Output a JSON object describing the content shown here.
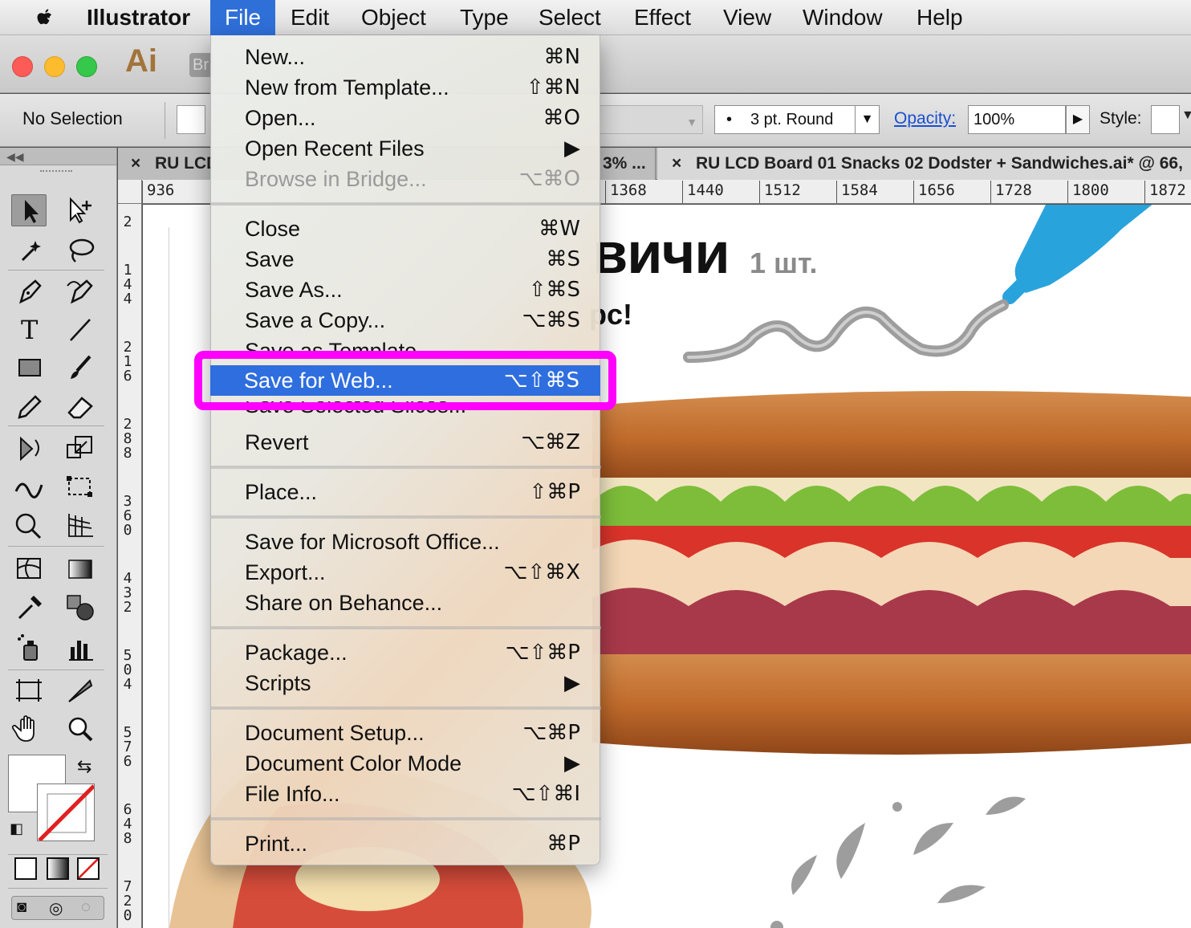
{
  "menubar": {
    "app_name": "Illustrator",
    "items": [
      "File",
      "Edit",
      "Object",
      "Type",
      "Select",
      "Effect",
      "View",
      "Window",
      "Help"
    ]
  },
  "appbar": {
    "logo": "Ai",
    "bridge_label": "Br"
  },
  "controlbar": {
    "selection": "No Selection",
    "brush_dot": "•",
    "brush": "3 pt. Round",
    "opacity_label": "Opacity:",
    "opacity_value": "100%",
    "style_label": "Style:"
  },
  "doc_tabs": {
    "tab1": "RU LCD",
    "tab2": "3% ...",
    "tab3": "RU LCD Board 01 Snacks 02 Dodster + Sandwiches.ai* @ 66,",
    "close_glyph": "×"
  },
  "hruler": [
    "936",
    "1368",
    "1440",
    "1512",
    "1584",
    "1656",
    "1728",
    "1800",
    "1872"
  ],
  "vruler": [
    "2",
    "1\n4\n4",
    "2\n1\n6",
    "2\n8\n8",
    "3\n6\n0",
    "4\n3\n2",
    "5\n0\n4",
    "5\n7\n6",
    "6\n4\n8",
    "7\n2\n0"
  ],
  "canvas": {
    "headline": "вичи",
    "headline_qty": "1 шт.",
    "subline": "рс!"
  },
  "file_menu": {
    "items": [
      {
        "label": "New...",
        "shortcut": "⌘N"
      },
      {
        "label": "New from Template...",
        "shortcut": "⇧⌘N"
      },
      {
        "label": "Open...",
        "shortcut": "⌘O"
      },
      {
        "label": "Open Recent Files",
        "shortcut": "▶"
      },
      {
        "label": "Browse in Bridge...",
        "shortcut": "⌥⌘O"
      },
      {
        "label": "Close",
        "shortcut": "⌘W"
      },
      {
        "label": "Save",
        "shortcut": "⌘S"
      },
      {
        "label": "Save As...",
        "shortcut": "⇧⌘S"
      },
      {
        "label": "Save a Copy...",
        "shortcut": "⌥⌘S"
      },
      {
        "label": "Save as Template...",
        "shortcut": ""
      },
      {
        "label": "Save for Web...",
        "shortcut": "⌥⇧⌘S"
      },
      {
        "label": "Save Selected Slices...",
        "shortcut": ""
      },
      {
        "label": "Revert",
        "shortcut": "⌥⌘Z"
      },
      {
        "label": "Place...",
        "shortcut": "⇧⌘P"
      },
      {
        "label": "Save for Microsoft Office...",
        "shortcut": ""
      },
      {
        "label": "Export...",
        "shortcut": "⌥⇧⌘X"
      },
      {
        "label": "Share on Behance...",
        "shortcut": ""
      },
      {
        "label": "Package...",
        "shortcut": "⌥⇧⌘P"
      },
      {
        "label": "Scripts",
        "shortcut": "▶"
      },
      {
        "label": "Document Setup...",
        "shortcut": "⌥⌘P"
      },
      {
        "label": "Document Color Mode",
        "shortcut": "▶"
      },
      {
        "label": "File Info...",
        "shortcut": "⌥⇧⌘I"
      },
      {
        "label": "Print...",
        "shortcut": "⌘P"
      }
    ]
  },
  "colors": {
    "menu_highlight": "#2f6ede",
    "annotation_frame": "#ff00ff",
    "ai_brand": "#a2743b",
    "ketchup_bottle": "#29a3dc"
  }
}
